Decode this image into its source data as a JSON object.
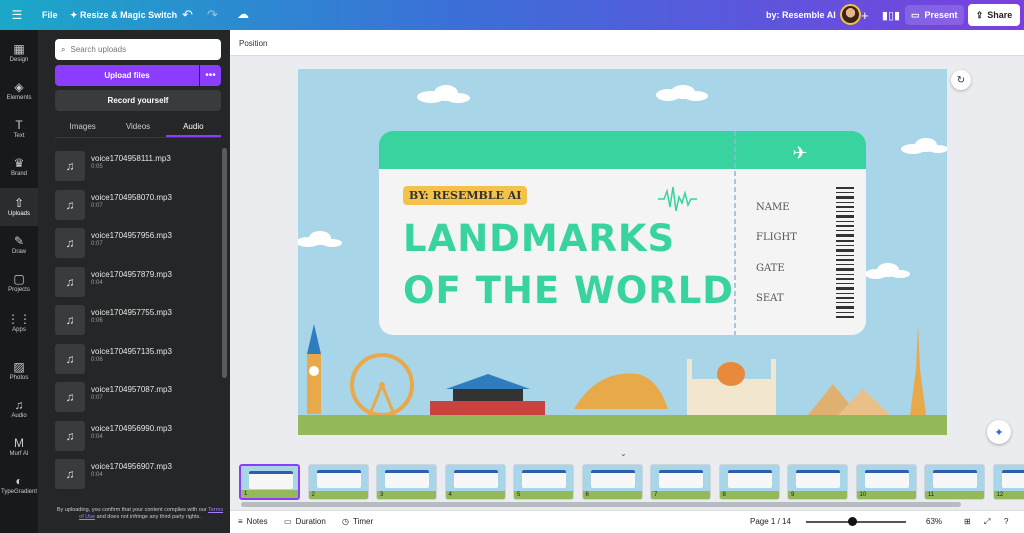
{
  "topbar": {
    "file": "File",
    "resize": "Resize & Magic Switch",
    "by": "by: Resemble AI",
    "present": "Present",
    "share": "Share"
  },
  "rail": [
    {
      "label": "Design",
      "icon": "design-icon"
    },
    {
      "label": "Elements",
      "icon": "elements-icon"
    },
    {
      "label": "Text",
      "icon": "text-icon"
    },
    {
      "label": "Brand",
      "icon": "brand-icon"
    },
    {
      "label": "Uploads",
      "icon": "uploads-icon"
    },
    {
      "label": "Draw",
      "icon": "draw-icon"
    },
    {
      "label": "Projects",
      "icon": "folder-icon"
    },
    {
      "label": "Apps",
      "icon": "apps-icon"
    },
    {
      "label": "Photos",
      "icon": "photos-icon"
    },
    {
      "label": "Audio",
      "icon": "audio-icon"
    },
    {
      "label": "Murf AI",
      "icon": "murf-icon"
    },
    {
      "label": "TypeGradient",
      "icon": "typegradient-icon"
    }
  ],
  "panel": {
    "search_placeholder": "Search uploads",
    "upload_label": "Upload files",
    "record_label": "Record yourself",
    "tabs": [
      "Images",
      "Videos",
      "Audio"
    ],
    "active_tab": "Audio",
    "audio": [
      {
        "name": "voice1704958111.mp3",
        "duration": "0:05"
      },
      {
        "name": "voice1704958070.mp3",
        "duration": "0:07"
      },
      {
        "name": "voice1704957956.mp3",
        "duration": "0:07"
      },
      {
        "name": "voice1704957879.mp3",
        "duration": "0:04"
      },
      {
        "name": "voice1704957755.mp3",
        "duration": "0:06"
      },
      {
        "name": "voice1704957135.mp3",
        "duration": "0:06"
      },
      {
        "name": "voice1704957087.mp3",
        "duration": "0:07"
      },
      {
        "name": "voice1704956990.mp3",
        "duration": "0:04"
      },
      {
        "name": "voice1704956907.mp3",
        "duration": "0:04"
      }
    ],
    "disclaimer_pre": "By uploading, you confirm that your content complies with our",
    "disclaimer_link": "Terms of Use",
    "disclaimer_post": "and does not infringe any third party rights."
  },
  "subbar": {
    "position": "Position"
  },
  "slide": {
    "badge": "BY: RESEMBLE AI",
    "title_line1": "LANDMARKS",
    "title_line2": "OF THE WORLD",
    "fields": [
      "NAME",
      "FLIGHT",
      "GATE",
      "SEAT"
    ],
    "colors": {
      "sky": "#a8d5e8",
      "ticket": "#38d39f",
      "badge": "#f3c24b",
      "ground": "#93b95a"
    }
  },
  "thumbnails": [
    "1",
    "2",
    "3",
    "4",
    "5",
    "6",
    "7",
    "8",
    "9",
    "10",
    "11",
    "12"
  ],
  "bottombar": {
    "notes": "Notes",
    "duration": "Duration",
    "timer": "Timer",
    "page": "Page 1 / 14",
    "zoom": "63%",
    "zoom_fraction": 0.46
  }
}
